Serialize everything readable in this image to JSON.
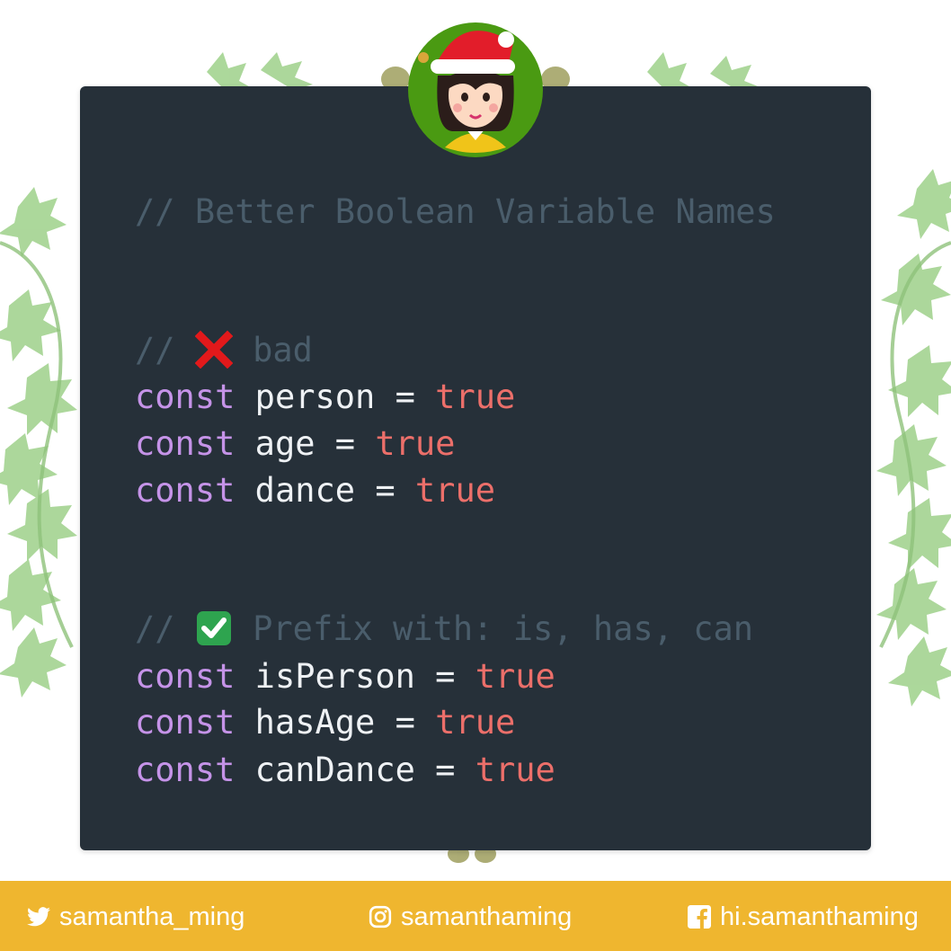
{
  "code": {
    "title_comment": "// Better Boolean Variable Names",
    "bad_section": {
      "comment_prefix": "//",
      "comment_text": "bad",
      "lines": [
        {
          "keyword": "const",
          "name": "person",
          "op": "=",
          "value": "true"
        },
        {
          "keyword": "const",
          "name": "age",
          "op": "=",
          "value": "true"
        },
        {
          "keyword": "const",
          "name": "dance",
          "op": "=",
          "value": "true"
        }
      ]
    },
    "good_section": {
      "comment_prefix": "//",
      "comment_text": "Prefix with: is, has, can",
      "lines": [
        {
          "keyword": "const",
          "name": "isPerson",
          "op": "=",
          "value": "true"
        },
        {
          "keyword": "const",
          "name": "hasAge",
          "op": "=",
          "value": "true"
        },
        {
          "keyword": "const",
          "name": "canDance",
          "op": "=",
          "value": "true"
        }
      ]
    }
  },
  "footer": {
    "twitter": "samantha_ming",
    "instagram": "samanthaming",
    "facebook": "hi.samanthaming"
  },
  "colors": {
    "card": "#263039",
    "comment": "#4a5d6b",
    "keyword": "#c593e8",
    "identifier": "#eef1f4",
    "boolean": "#ec6f6a",
    "footer": "#efb62f",
    "avatar_ring": "#4a9a12"
  },
  "icons": [
    "cross-mark-icon",
    "check-mark-icon",
    "twitter-icon",
    "instagram-icon",
    "facebook-icon",
    "avatar-santa-hat"
  ]
}
